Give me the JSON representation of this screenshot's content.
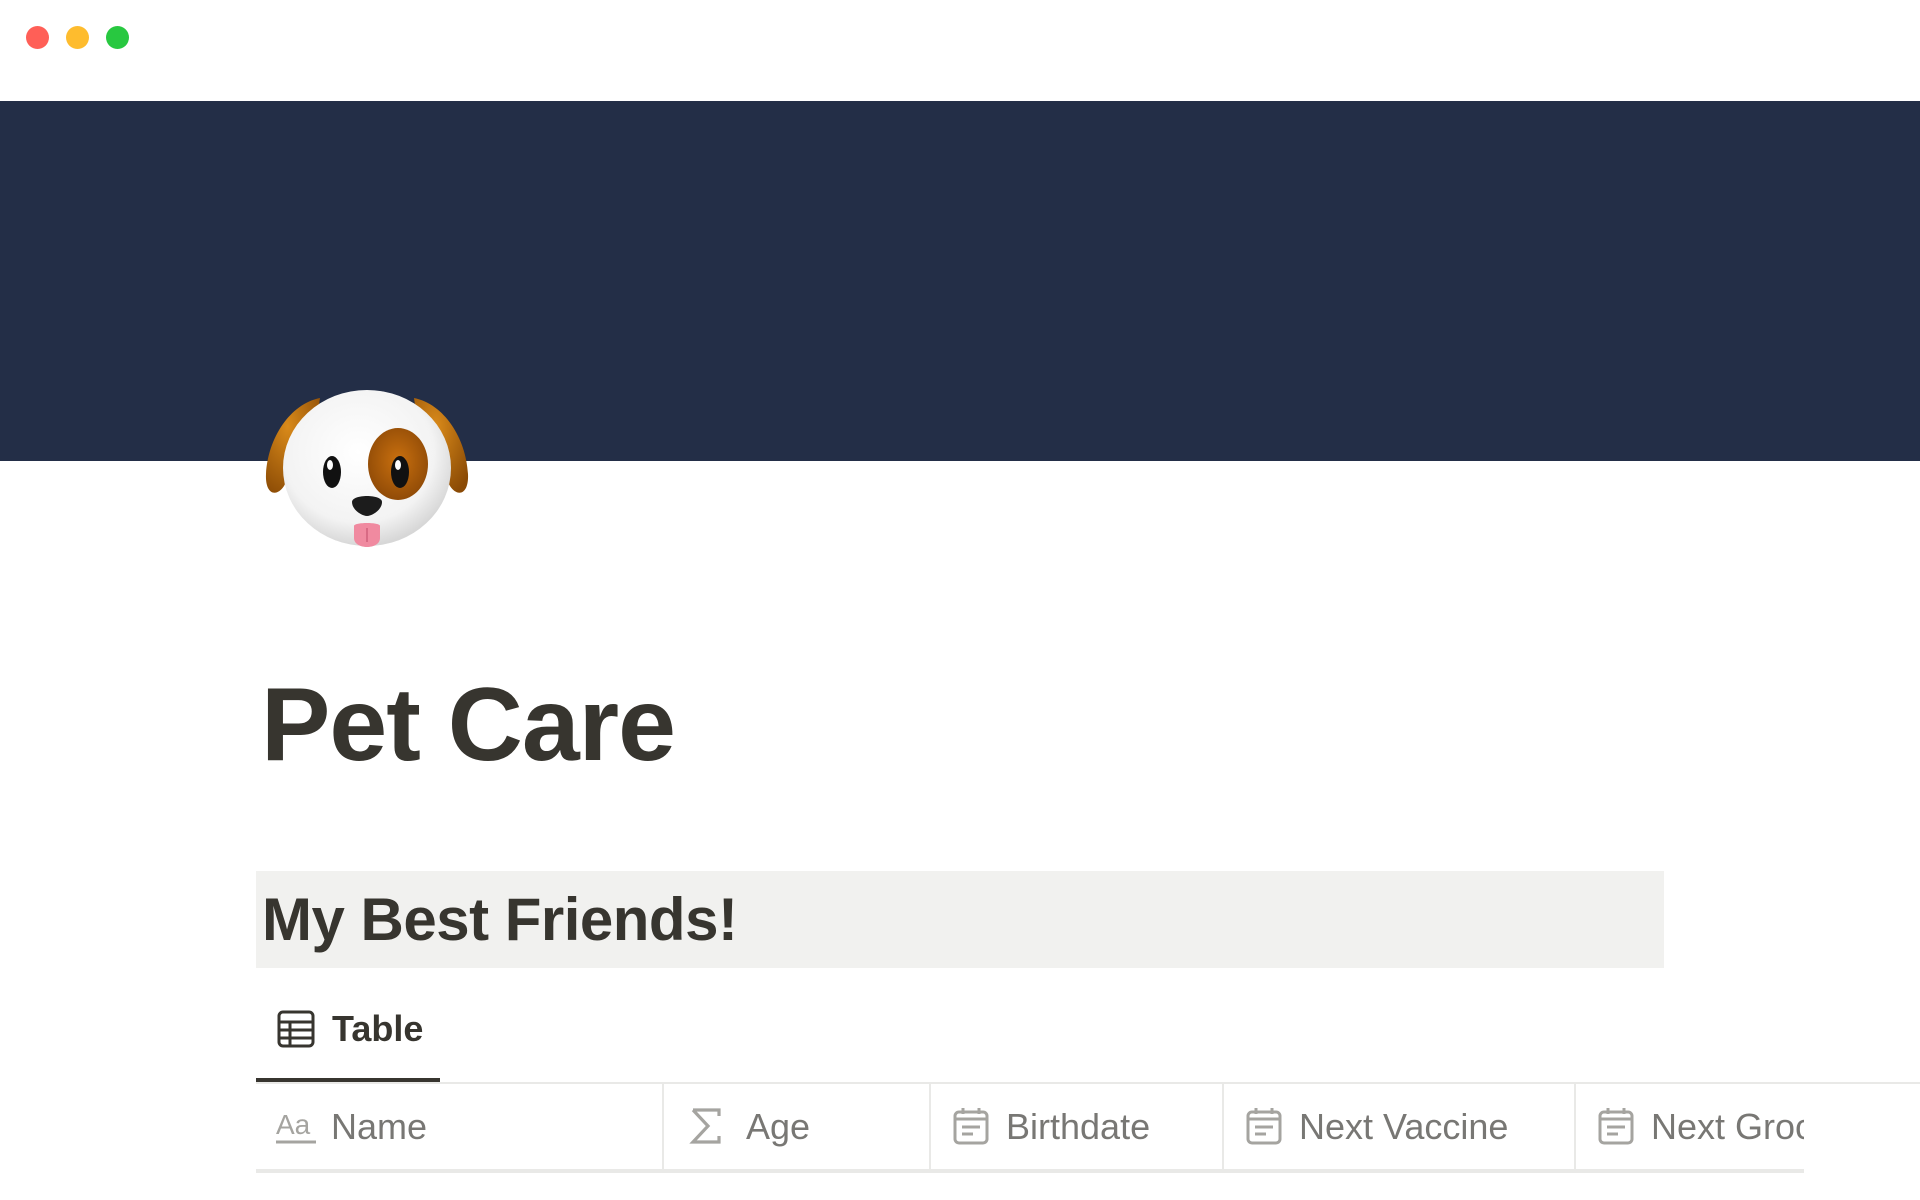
{
  "window": {
    "controls": [
      "close",
      "minimize",
      "zoom"
    ]
  },
  "cover": {
    "color": "#232e47"
  },
  "page": {
    "icon": "dog-face-icon",
    "title": "Pet Care"
  },
  "section": {
    "heading": "My Best Friends!"
  },
  "view_tabs": [
    {
      "label": "Table",
      "icon": "table-icon",
      "active": true
    }
  ],
  "table": {
    "columns": [
      {
        "label": "Name",
        "icon": "text-property-icon"
      },
      {
        "label": "Age",
        "icon": "formula-sigma-icon"
      },
      {
        "label": "Birthdate",
        "icon": "calendar-icon"
      },
      {
        "label": "Next Vaccine",
        "icon": "calendar-icon"
      },
      {
        "label": "Next Groc",
        "icon": "calendar-icon"
      }
    ]
  }
}
